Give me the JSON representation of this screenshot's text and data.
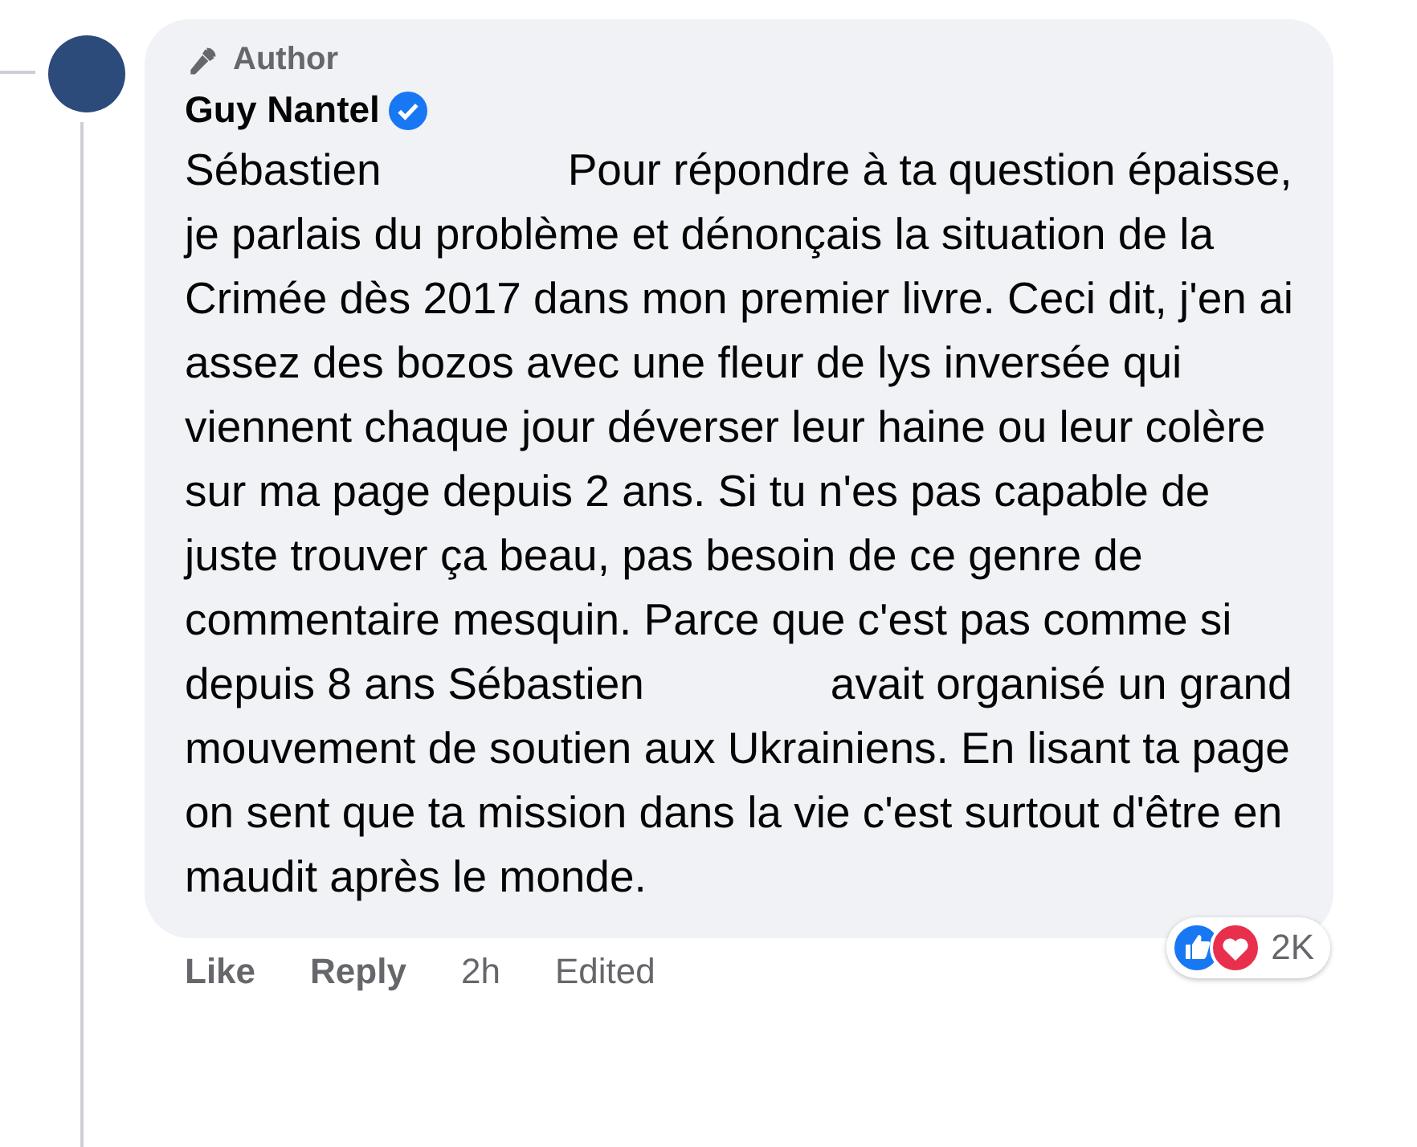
{
  "comment": {
    "badge": "Author",
    "author": "Guy Nantel",
    "verified": true,
    "body": [
      {
        "kind": "text",
        "text": "Sébastien"
      },
      {
        "kind": "redaction"
      },
      {
        "kind": "text",
        "text": "Pour répondre à ta question épaisse, je parlais du problème et dénonçais la situation de la Crimée dès 2017 dans mon premier livre. Ceci dit, j'en ai assez des bozos avec une fleur de lys inversée qui viennent chaque jour déverser leur haine ou leur colère sur ma page depuis 2 ans. Si tu n'es pas capable de juste trouver ça beau, pas besoin de ce genre de commentaire mesquin. Parce que c'est pas comme si depuis 8 ans Sébastien"
      },
      {
        "kind": "redaction"
      },
      {
        "kind": "text",
        "text": "avait organisé un grand mouvement de soutien aux Ukrainiens. En lisant ta page on sent que ta mission dans la vie c'est surtout d'être en maudit après le monde."
      }
    ],
    "reactions": {
      "count": "2K"
    },
    "actions": [
      "Like",
      "Reply"
    ],
    "time": "2h",
    "edited": "Edited"
  }
}
